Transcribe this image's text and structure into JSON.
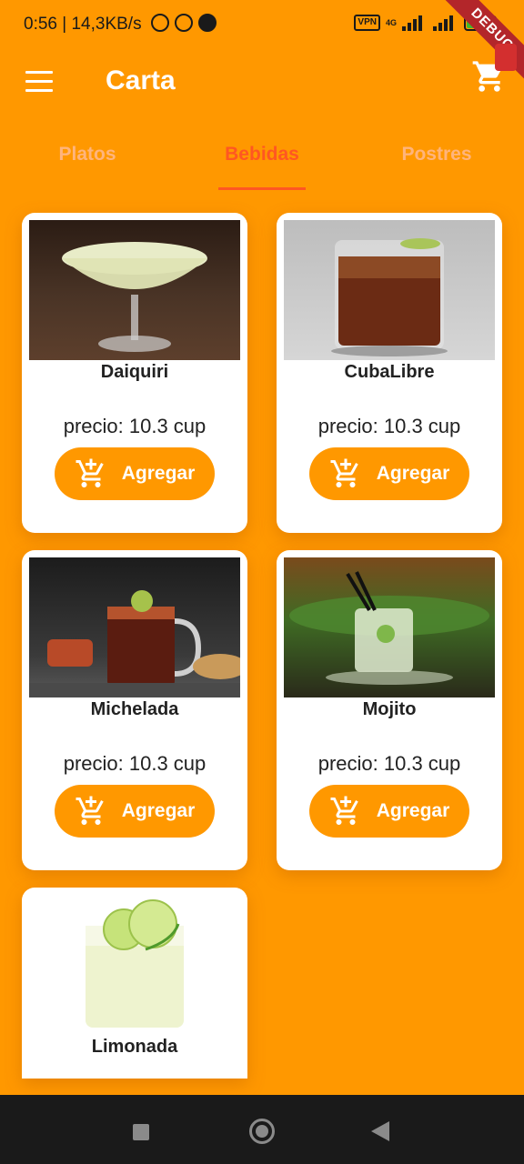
{
  "status_bar": {
    "time": "0:56 | 14,3KB/s",
    "vpn": "VPN",
    "network": "4G",
    "battery": "60"
  },
  "debug_banner": "DEBUG",
  "app_bar": {
    "title": "Carta",
    "menu_icon": "menu-icon",
    "cart_icon": "shopping-cart-icon"
  },
  "tabs": [
    {
      "label": "Platos",
      "selected": false
    },
    {
      "label": "Bebidas",
      "selected": true
    },
    {
      "label": "Postres",
      "selected": false
    }
  ],
  "products": [
    {
      "name": "Daiquiri",
      "price": "precio: 10.3 cup",
      "button": "Agregar"
    },
    {
      "name": "CubaLibre",
      "price": "precio: 10.3 cup",
      "button": "Agregar"
    },
    {
      "name": "Michelada",
      "price": "precio: 10.3 cup",
      "button": "Agregar"
    },
    {
      "name": "Mojito",
      "price": "precio: 10.3 cup",
      "button": "Agregar"
    },
    {
      "name": "Limonada"
    }
  ],
  "colors": {
    "background": "#ff9800",
    "accent": "#ff5722",
    "card": "#ffffff"
  }
}
